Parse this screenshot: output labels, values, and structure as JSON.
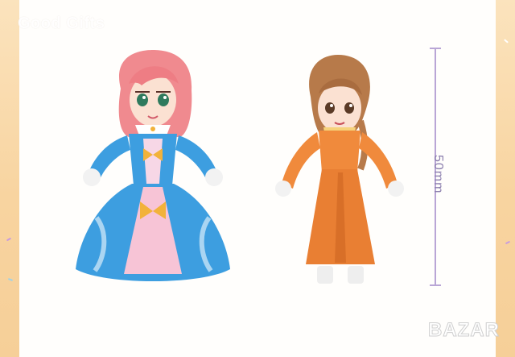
{
  "watermark": {
    "text": "Good Gifts"
  },
  "measurement": {
    "label": "50mm"
  },
  "logo": {
    "text": "BAZAR"
  },
  "colors": {
    "side_panel": "#f8d4a0",
    "measure_line": "#b9a6d6",
    "princess_dress": "#3d9ee0",
    "princess_hair": "#f08a8f",
    "lady_dress": "#f08a3c",
    "lady_hair": "#b77a4a"
  },
  "figures": [
    {
      "name": "princess-figure",
      "hair": "pink",
      "dress": "blue ball gown with yellow bows"
    },
    {
      "name": "lady-figure",
      "hair": "brown",
      "dress": "orange long dress"
    }
  ]
}
